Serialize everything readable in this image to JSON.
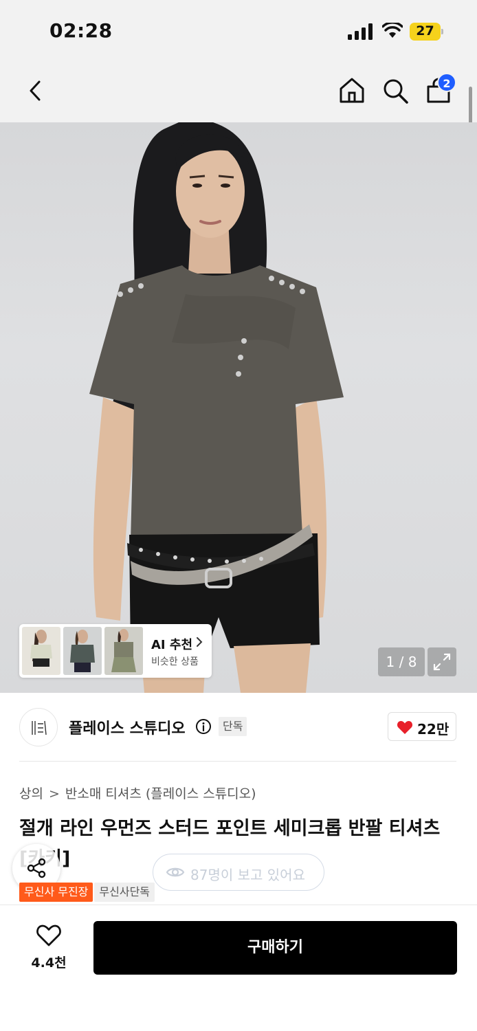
{
  "status_bar": {
    "time": "02:28",
    "battery": "27",
    "signal_icon": "cellular-signal-icon",
    "wifi_icon": "wifi-icon"
  },
  "nav": {
    "back_icon": "chevron-left-icon",
    "home_icon": "home-icon",
    "search_icon": "search-icon",
    "cart_icon": "shopping-bag-icon",
    "cart_badge": "2"
  },
  "gallery": {
    "counter": "1 / 8",
    "ai_recommend": {
      "title": "AI 추천",
      "subtitle": "비슷한 상품"
    }
  },
  "brand": {
    "name": "플레이스 스튜디오",
    "exclusive_label": "단독",
    "likes": "22만",
    "accent_color": "#e8202a"
  },
  "breadcrumb": {
    "category": "상의",
    "subcategory": "반소매 티셔츠 (플레이스 스튜디오)"
  },
  "product": {
    "title": "절개 라인 우먼즈 스터드 포인트 세미크롭 반팔 티셔츠 [카키]",
    "viewers": "87명이 보고 있어요",
    "tags": [
      "무신사 무진장",
      "무신사단독"
    ],
    "tag_colors": [
      "#ff5a1a",
      "#efefef"
    ]
  },
  "bottom_bar": {
    "wish_count": "4.4천",
    "buy_label": "구매하기"
  }
}
